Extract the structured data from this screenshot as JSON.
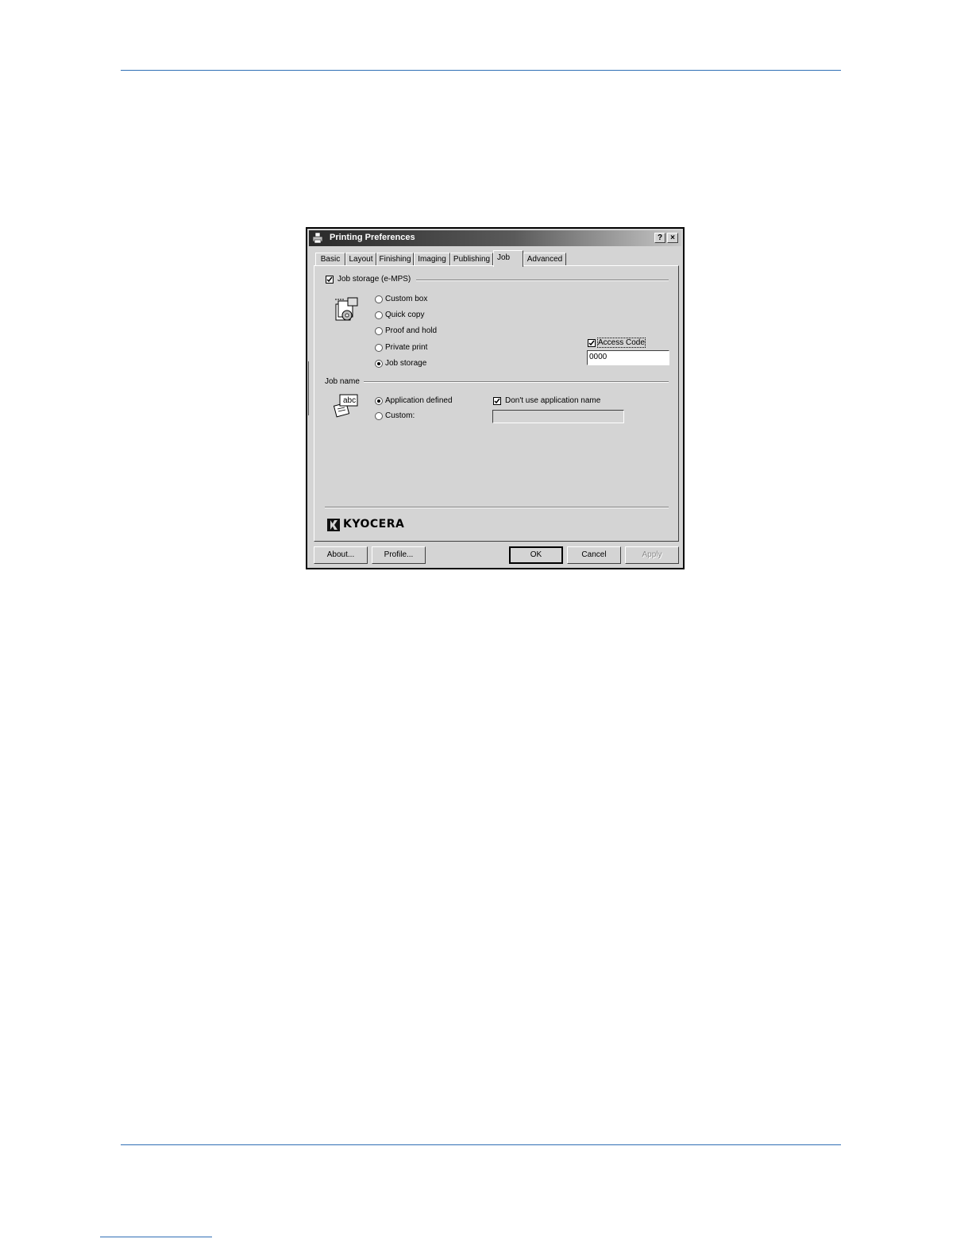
{
  "dialog": {
    "title": "Printing Preferences",
    "help_glyph": "?",
    "close_glyph": "×",
    "tabs": [
      {
        "label": "Basic"
      },
      {
        "label": "Layout"
      },
      {
        "label": "Finishing"
      },
      {
        "label": "Imaging"
      },
      {
        "label": "Publishing"
      },
      {
        "label": "Job",
        "active": true
      },
      {
        "label": "Advanced"
      }
    ]
  },
  "job_storage": {
    "label": "Job storage (e-MPS)",
    "checked": true,
    "icon": "job-storage-icon",
    "options": [
      {
        "label": "Custom box",
        "selected": false
      },
      {
        "label": "Quick copy",
        "selected": false
      },
      {
        "label": "Proof and hold",
        "selected": false
      },
      {
        "label": "Private print",
        "selected": false
      },
      {
        "label": "Job storage",
        "selected": true
      }
    ],
    "access_code": {
      "label": "Access Code",
      "checked": true,
      "value": "0000"
    }
  },
  "job_name": {
    "label": "Job name",
    "icon": "abc-document-icon",
    "icon_text": "abc",
    "options": [
      {
        "label": "Application defined",
        "selected": true
      },
      {
        "label": "Custom:",
        "selected": false
      }
    ],
    "dont_use_app_name": {
      "label": "Don't use application name",
      "checked": true
    },
    "custom_value": ""
  },
  "brand": {
    "name": "KYOCERA"
  },
  "buttons": {
    "about": "About...",
    "profile": "Profile...",
    "ok": "OK",
    "cancel": "Cancel",
    "apply": "Apply"
  }
}
